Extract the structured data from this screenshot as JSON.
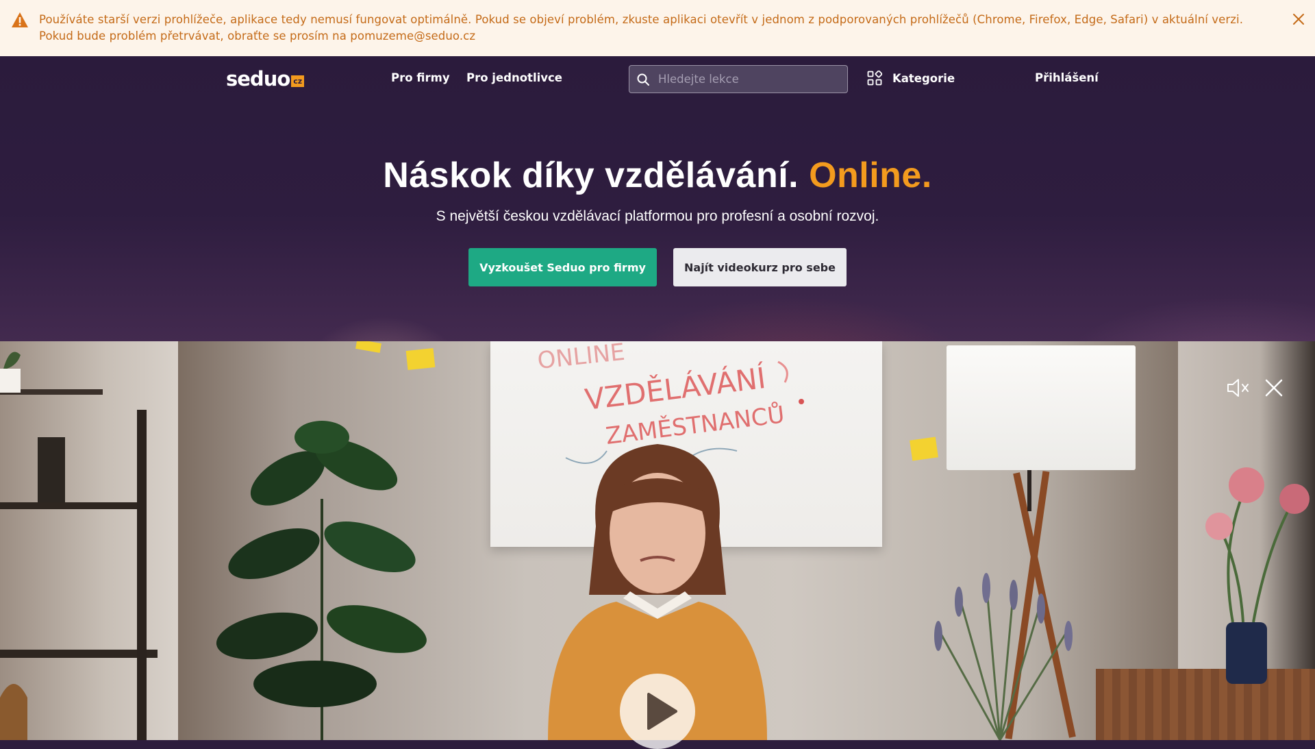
{
  "banner": {
    "message": "Používáte starší verzi prohlížeče, aplikace tedy nemusí fungovat optimálně. Pokud se objeví problém, zkuste aplikaci otevřít v jednom z podporovaných prohlížečů (Chrome, Firefox, Edge, Safari) v aktuální verzi. Pokud bude problém přetrvávat, obraťte se prosím na pomuzeme@seduo.cz",
    "icon": "warning-icon",
    "close_icon": "close-icon",
    "text_color": "#c46a17",
    "background": "#fdf4ea"
  },
  "header": {
    "logo_text": "seduo",
    "logo_badge": "cz",
    "nav": {
      "pro_firmy": "Pro firmy",
      "pro_jednotlivce": "Pro jednotlivce"
    },
    "search": {
      "placeholder": "Hledejte lekce",
      "value": ""
    },
    "kategorie_label": "Kategorie",
    "login_label": "Přihlášení"
  },
  "hero": {
    "title_main": "Náskok díky vzdělávání.",
    "title_accent": "Online.",
    "subtitle": "S největší českou vzdělávací platformou pro profesní a osobní rozvoj.",
    "primary_button": "Vyzkoušet Seduo pro firmy",
    "secondary_button": "Najít videokurz pro sebe",
    "accent_color": "#f39b1e",
    "primary_color": "#1ea984"
  },
  "video": {
    "controls": [
      "mute-icon",
      "close-icon",
      "play-icon"
    ],
    "whiteboard_text": [
      "ONLINE",
      "VZDĚLÁVÁNÍ",
      "ZAMĚSTNANCŮ"
    ]
  }
}
